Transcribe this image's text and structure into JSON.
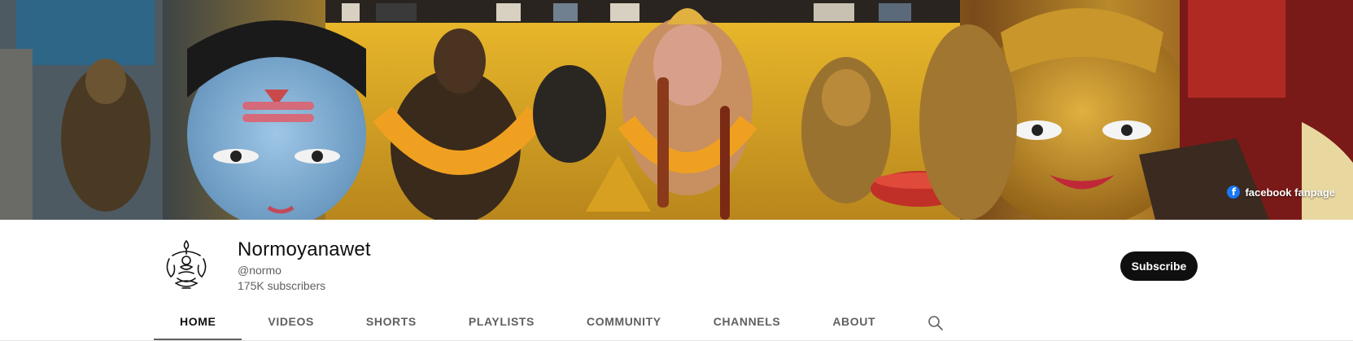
{
  "banner": {
    "link_label": "facebook fanpage",
    "link_icon": "facebook-icon",
    "link_icon_color": "#1877f2"
  },
  "channel": {
    "name": "Normoyanawet",
    "handle": "@normo",
    "subscribers": "175K subscribers",
    "avatar_icon": "sacred-symbol-logo"
  },
  "subscribe": {
    "label": "Subscribe",
    "background": "#0f0f0f",
    "text_color": "#ffffff"
  },
  "tabs": [
    {
      "label": "HOME",
      "active": true
    },
    {
      "label": "VIDEOS",
      "active": false
    },
    {
      "label": "SHORTS",
      "active": false
    },
    {
      "label": "PLAYLISTS",
      "active": false
    },
    {
      "label": "COMMUNITY",
      "active": false
    },
    {
      "label": "CHANNELS",
      "active": false
    },
    {
      "label": "ABOUT",
      "active": false
    }
  ],
  "search_icon": "search-icon"
}
